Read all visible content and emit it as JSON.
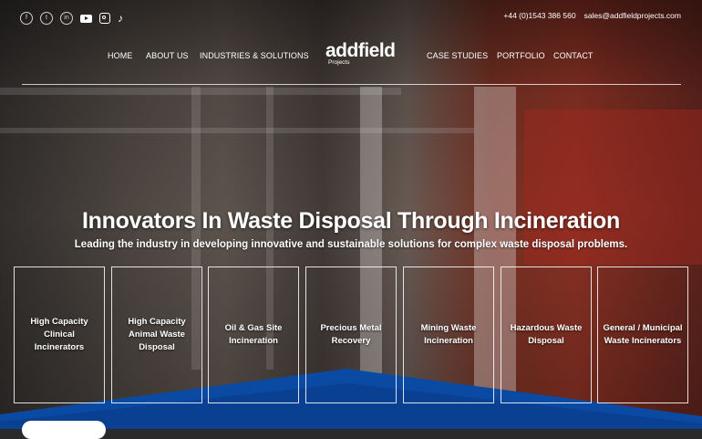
{
  "social": {
    "icons": [
      "facebook-icon",
      "twitter-icon",
      "linkedin-icon",
      "youtube-icon",
      "instagram-icon",
      "tiktok-icon"
    ]
  },
  "contact": {
    "phone": "+44 (0)1543 386 560",
    "email": "sales@addfieldprojects.com"
  },
  "nav": {
    "left": [
      "HOME",
      "ABOUT US",
      "INDUSTRIES & SOLUTIONS"
    ],
    "right": [
      "CASE STUDIES",
      "PORTFOLIO",
      "CONTACT"
    ]
  },
  "logo": {
    "word": "addfield",
    "sub": "Projects"
  },
  "hero": {
    "headline": "Innovators In Waste Disposal Through Incineration",
    "subline": "Leading the industry in developing innovative and sustainable solutions for complex waste disposal problems."
  },
  "cards": [
    "High Capacity Clinical Incinerators",
    "High Capacity Animal Waste Disposal",
    "Oil & Gas Site Incineration",
    "Precious Metal Recovery",
    "Mining Waste Incineration",
    "Hazardous Waste Disposal",
    "General / Municipal Waste Incinerators"
  ],
  "colors": {
    "accent_blue": "#0a4aa3",
    "white": "#ffffff"
  }
}
